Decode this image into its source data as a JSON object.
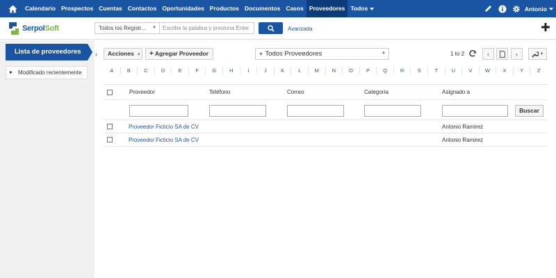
{
  "nav": {
    "items": [
      "Calendario",
      "Prospectos",
      "Cuentas",
      "Contactos",
      "Oportunidades",
      "Productos",
      "Documentos",
      "Casos",
      "Proveedores",
      "Todos"
    ],
    "active": "Proveedores",
    "user": "Antonio",
    "icons": [
      "home-icon",
      "pencil-icon",
      "info-icon",
      "gear-icon"
    ]
  },
  "header": {
    "logo_a": "Serpol",
    "logo_b": "Soft",
    "module_select": "Todos los Registr...",
    "search_placeholder": "Escribe la palabra y presiona Enter",
    "advanced": "Avanzada"
  },
  "sidebar": {
    "title": "Lista de proveedores",
    "items": [
      "Modificado recientemente"
    ]
  },
  "toolbar": {
    "actions": "Acciones",
    "add": "Agregar Proveedor",
    "filter": "Todos Proveedores",
    "pager": "1 to 2"
  },
  "alphabet": [
    "A",
    "B",
    "C",
    "D",
    "E",
    "F",
    "G",
    "H",
    "I",
    "J",
    "K",
    "L",
    "M",
    "N",
    "O",
    "P",
    "Q",
    "R",
    "S",
    "T",
    "U",
    "V",
    "W",
    "X",
    "Y",
    "Z"
  ],
  "grid": {
    "columns": [
      "Proveedor",
      "Teléfono",
      "Correo",
      "Categoría",
      "Asignado a"
    ],
    "search_button": "Buscar",
    "rows": [
      {
        "proveedor": "Proveedor Ficticio SA de CV",
        "telefono": "",
        "correo": "",
        "categoria": "",
        "asignado": "Antonio Ramirez"
      },
      {
        "proveedor": "Proveedor Ficticio SA de CV",
        "telefono": "",
        "correo": "",
        "categoria": "",
        "asignado": "Antonio Ramirez"
      }
    ]
  },
  "colors": {
    "primary": "#1a55a3",
    "active_tab": "#0d3c7c",
    "logo_green": "#7ab648"
  }
}
